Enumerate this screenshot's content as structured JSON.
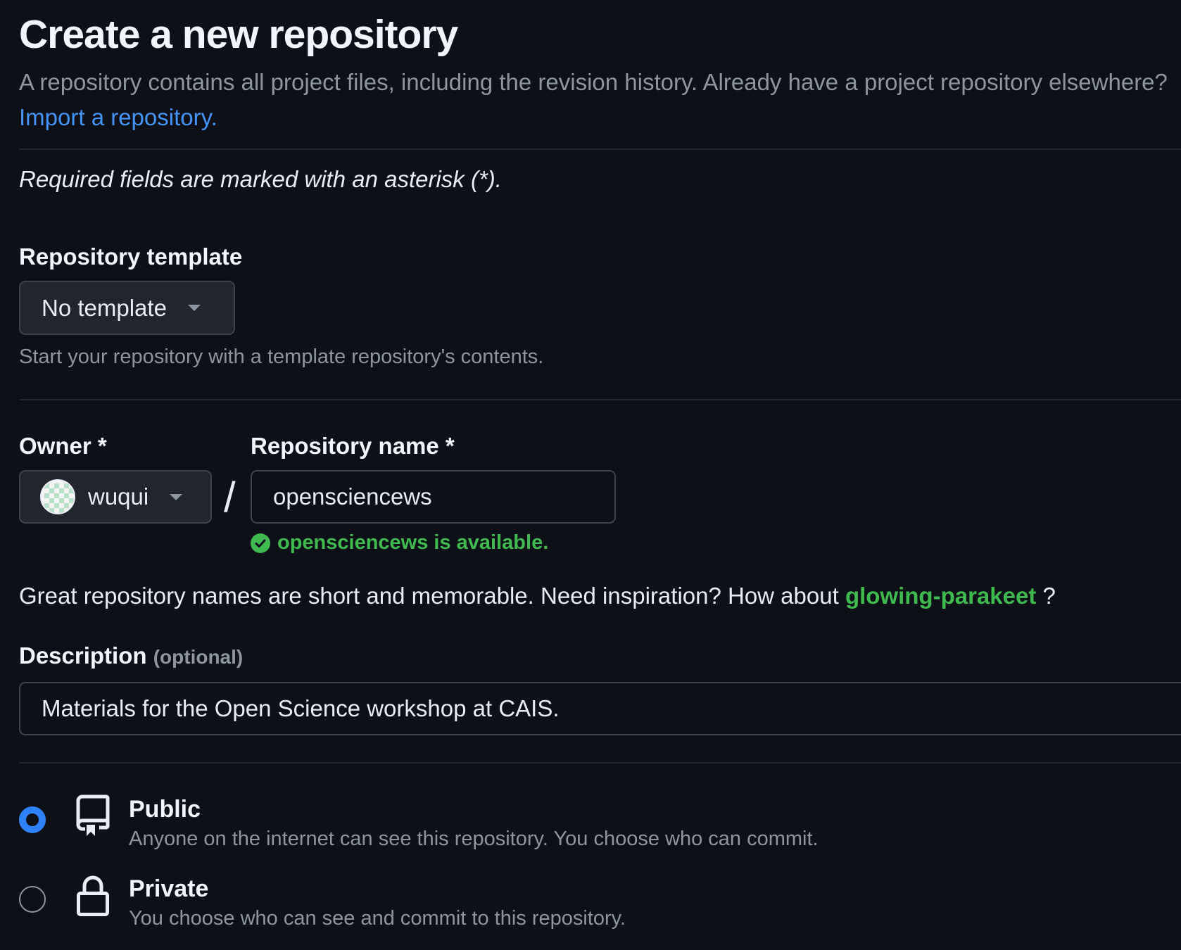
{
  "header": {
    "title": "Create a new repository",
    "subtitle": "A repository contains all project files, including the revision history. Already have a project repository elsewhere?",
    "import_link": "Import a repository."
  },
  "required_note": "Required fields are marked with an asterisk (*).",
  "template": {
    "label": "Repository template",
    "value": "No template",
    "hint": "Start your repository with a template repository's contents."
  },
  "owner": {
    "label": "Owner *",
    "value": "wuqui"
  },
  "separator": "/",
  "repo_name": {
    "label": "Repository name *",
    "value": "opensciencews",
    "availability": "opensciencews is available."
  },
  "inspiration": {
    "text": "Great repository names are short and memorable. Need inspiration? How about",
    "suggestion": "glowing-parakeet",
    "suffix": "?"
  },
  "description": {
    "label": "Description",
    "optional": "(optional)",
    "value": "Materials for the Open Science workshop at CAIS."
  },
  "visibility": {
    "selected": "public",
    "options": [
      {
        "title": "Public",
        "desc": "Anyone on the internet can see this repository. You choose who can commit.",
        "icon": "repo-icon"
      },
      {
        "title": "Private",
        "desc": "You choose who can see and commit to this repository.",
        "icon": "lock-icon"
      }
    ]
  },
  "colors": {
    "background": "#0d1117",
    "link": "#4493f8",
    "success": "#3fb950",
    "radio_selected": "#2f81f7"
  }
}
